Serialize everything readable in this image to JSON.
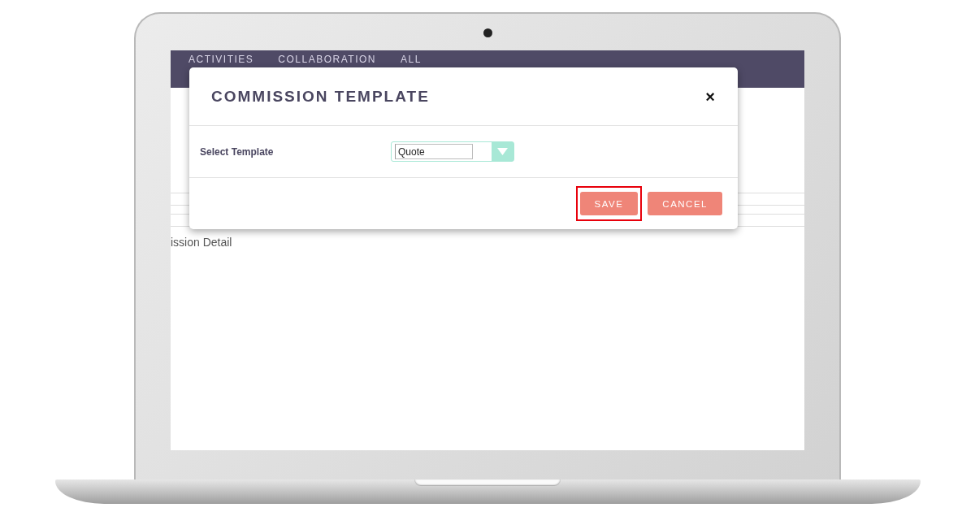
{
  "nav_items": [
    "ACTIVITIES",
    "COLLABORATION",
    "ALL"
  ],
  "page": {
    "heading": "ission Detail"
  },
  "dialog": {
    "title": "COMMISSION TEMPLATE",
    "close_label": "×",
    "fields": [
      {
        "label": "Select Template",
        "value": "Quote"
      }
    ],
    "buttons": [
      {
        "label": "SAVE",
        "highlighted": true
      },
      {
        "label": "CANCEL",
        "highlighted": false
      }
    ]
  }
}
